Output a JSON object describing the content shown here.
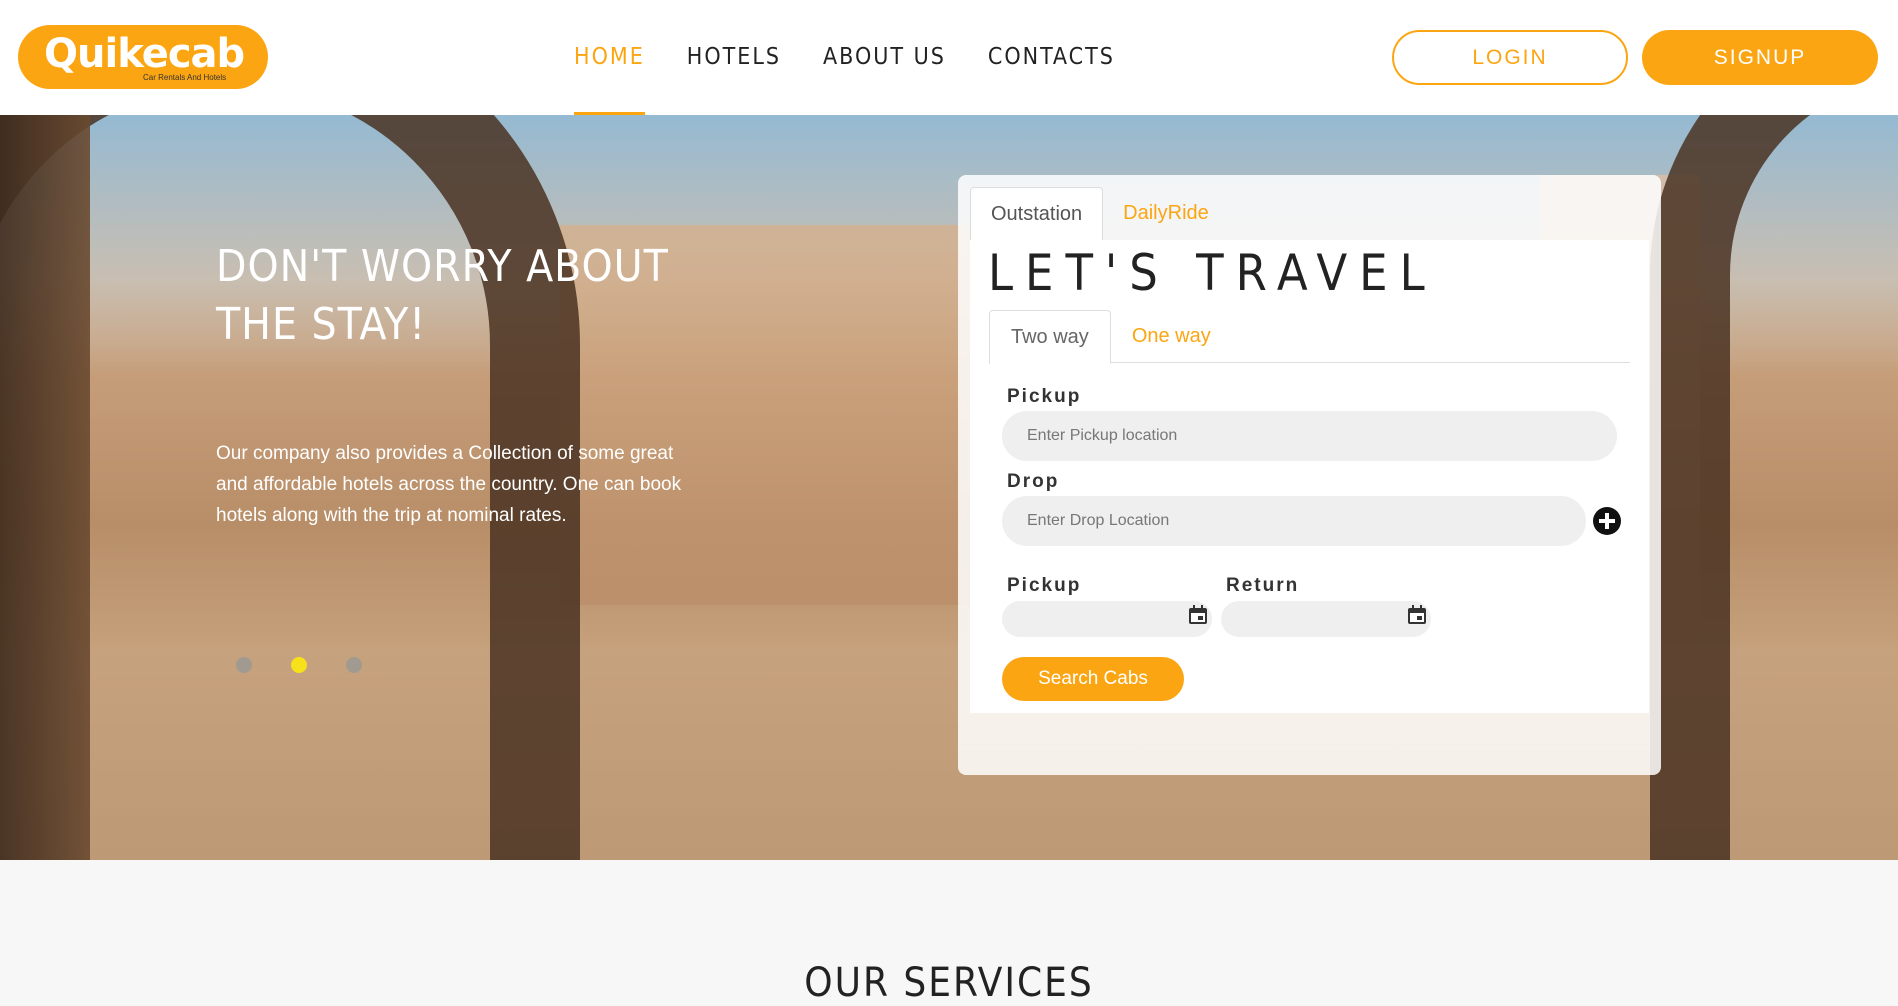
{
  "brand": {
    "name": "Quikecab",
    "tagline": "Car Rentals And Hotels",
    "accent": "#fca512"
  },
  "nav": {
    "items": [
      "HOME",
      "HOTELS",
      "ABOUT US",
      "CONTACTS"
    ],
    "active": "HOME"
  },
  "auth": {
    "login_label": "LOGIN",
    "signup_label": "SIGNUP"
  },
  "hero": {
    "title_line1": "DON'T WORRY ABOUT",
    "title_line2": "THE STAY!",
    "text": "Our company also provides a Collection of some great and affordable hotels across the country. One can book hotels along with the trip at nominal rates.",
    "slides": {
      "count": 3,
      "active": 2
    }
  },
  "booking": {
    "tabs": [
      "Outstation",
      "DailyRide"
    ],
    "active_tab": "Outstation",
    "title": "LET'S TRAVEL",
    "trip_tabs": [
      "Two way",
      "One way"
    ],
    "active_trip_tab": "Two way",
    "pickup_label": "Pickup",
    "pickup_placeholder": "Enter Pickup location",
    "drop_label": "Drop",
    "drop_placeholder": "Enter Drop Location",
    "pickup_date_label": "Pickup",
    "return_date_label": "Return",
    "search_label": "Search Cabs"
  },
  "services": {
    "title": "OUR SERVICES"
  }
}
